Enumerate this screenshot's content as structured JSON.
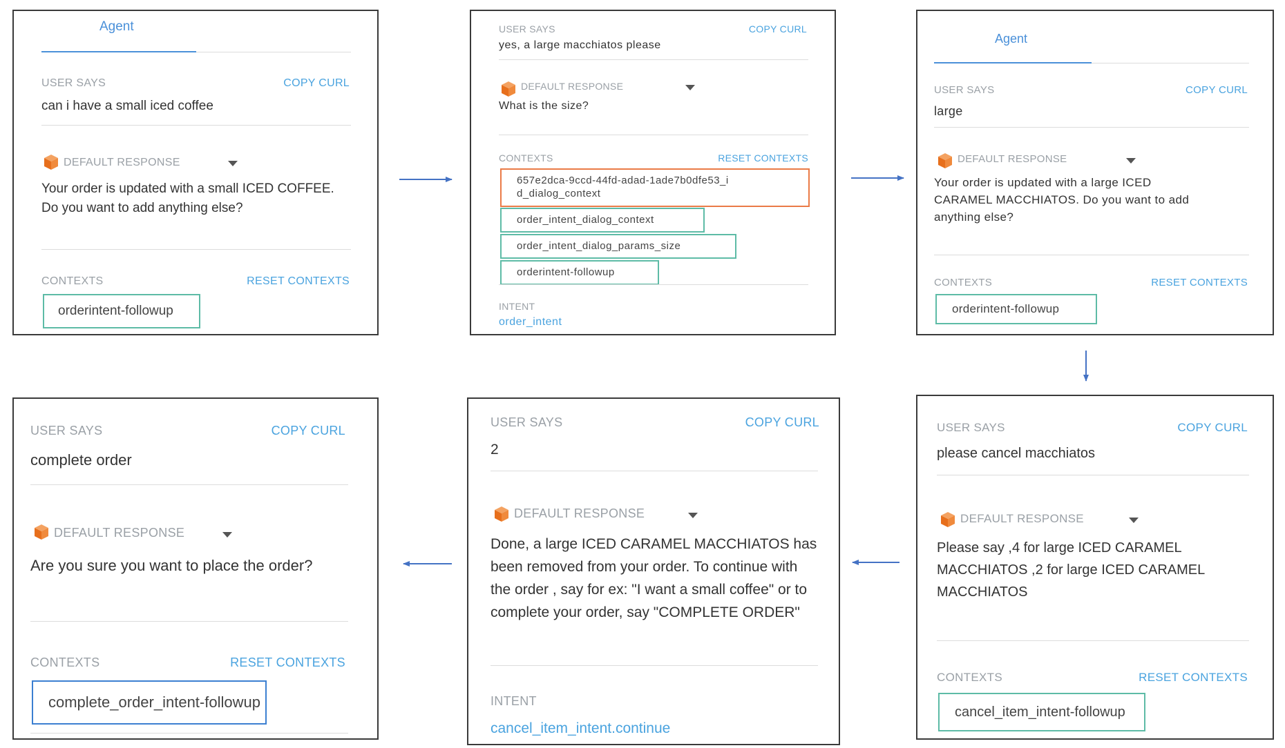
{
  "panels": {
    "p1": {
      "tab": "Agent",
      "user_says_label": "USER SAYS",
      "copy_curl": "COPY CURL",
      "user_says": "can i have a small iced coffee",
      "default_response_label": "DEFAULT RESPONSE",
      "response_lines": [
        "Your order is updated with a small ICED COFFEE.",
        "Do you want to add anything else?"
      ],
      "contexts_label": "CONTEXTS",
      "reset_contexts": "RESET CONTEXTS",
      "contexts": [
        "orderintent-followup"
      ]
    },
    "p2": {
      "user_says_label": "USER SAYS",
      "copy_curl": "COPY CURL",
      "user_says": "yes, a large macchiatos please",
      "default_response_label": "DEFAULT RESPONSE",
      "response_lines": [
        "What is the size?"
      ],
      "contexts_label": "CONTEXTS",
      "reset_contexts": "RESET CONTEXTS",
      "contexts": [
        "657e2dca-9ccd-44fd-adad-1ade7b0dfe53_i",
        "d_dialog_context",
        "order_intent_dialog_context",
        "order_intent_dialog_params_size",
        "orderintent-followup"
      ],
      "intent_label": "INTENT",
      "intent": "order_intent"
    },
    "p3": {
      "tab": "Agent",
      "user_says_label": "USER SAYS",
      "copy_curl": "COPY CURL",
      "user_says": "large",
      "default_response_label": "DEFAULT RESPONSE",
      "response_lines": [
        "Your order is updated with a large ICED",
        "CARAMEL MACCHIATOS. Do you want to add",
        "anything else?"
      ],
      "contexts_label": "CONTEXTS",
      "reset_contexts": "RESET CONTEXTS",
      "contexts": [
        "orderintent-followup"
      ]
    },
    "p4": {
      "user_says_label": "USER SAYS",
      "copy_curl": "COPY CURL",
      "user_says": "please cancel macchiatos",
      "default_response_label": "DEFAULT RESPONSE",
      "response_lines": [
        "Please say ,4 for large ICED CARAMEL",
        "MACCHIATOS ,2 for large ICED CARAMEL",
        "MACCHIATOS"
      ],
      "contexts_label": "CONTEXTS",
      "reset_contexts": "RESET CONTEXTS",
      "contexts": [
        "cancel_item_intent-followup"
      ]
    },
    "p5": {
      "user_says_label": "USER SAYS",
      "copy_curl": "COPY CURL",
      "user_says": "2",
      "default_response_label": "DEFAULT RESPONSE",
      "response_lines": [
        "Done, a large ICED CARAMEL MACCHIATOS has",
        "been removed from your order. To continue with",
        "the order , say for ex: \"I want a small coffee\" or to",
        "complete your order, say \"COMPLETE ORDER\""
      ],
      "intent_label": "INTENT",
      "intent": "cancel_item_intent.continue"
    },
    "p6": {
      "user_says_label": "USER SAYS",
      "copy_curl": "COPY CURL",
      "user_says": "complete order",
      "default_response_label": "DEFAULT RESPONSE",
      "response_lines": [
        "Are you sure you want to place the order?"
      ],
      "contexts_label": "CONTEXTS",
      "reset_contexts": "RESET CONTEXTS",
      "contexts": [
        "complete_order_intent-followup"
      ]
    }
  },
  "colors": {
    "link_blue": "#4aa3df",
    "chip_green": "#5dbba6",
    "chip_orange": "#ea7a46",
    "chip_blue": "#3b7fd1",
    "arrow_blue": "#4472c4",
    "cube_orange": "#f08a3c"
  }
}
